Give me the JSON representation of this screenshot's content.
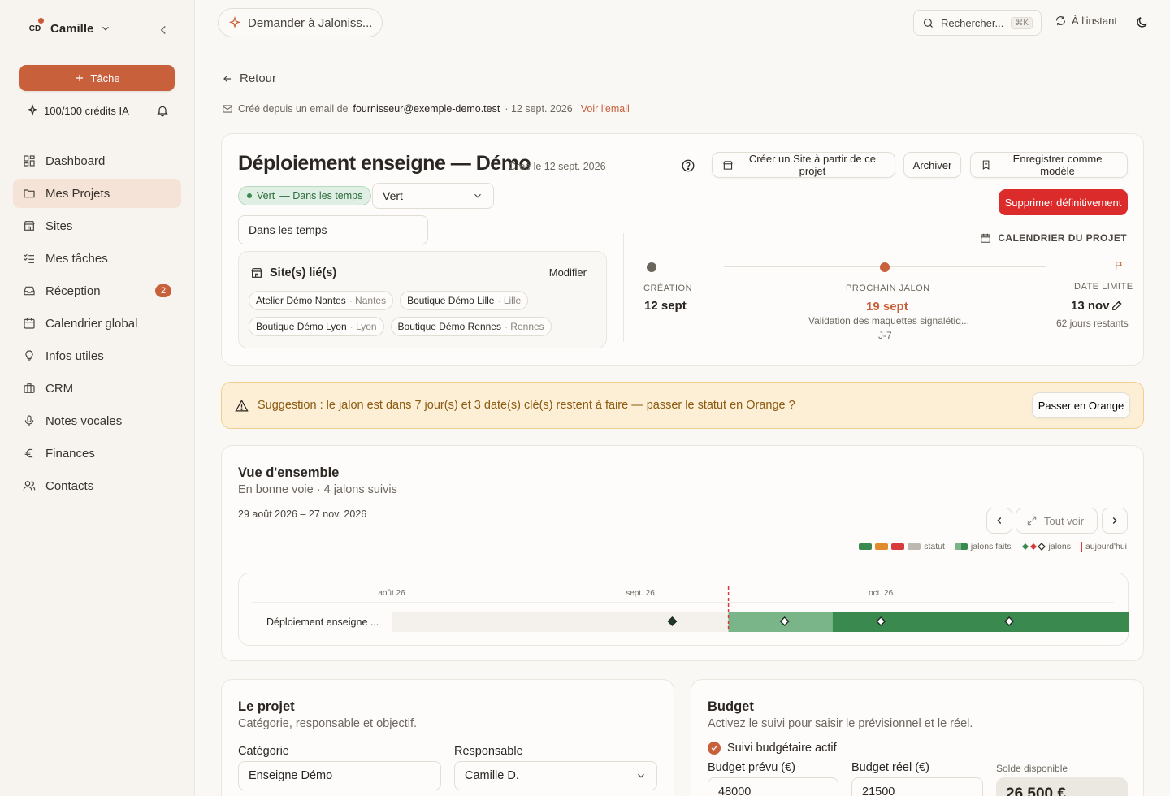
{
  "sidebar": {
    "avatar_initials": "CD",
    "user_name": "Camille",
    "task_button": "Tâche",
    "credits": "100/100 crédits IA",
    "items": [
      {
        "label": "Dashboard",
        "icon": "dashboard-icon"
      },
      {
        "label": "Mes Projets",
        "icon": "folder-icon",
        "active": true
      },
      {
        "label": "Sites",
        "icon": "store-icon"
      },
      {
        "label": "Mes tâches",
        "icon": "checklist-icon"
      },
      {
        "label": "Réception",
        "icon": "inbox-icon",
        "badge": "2"
      },
      {
        "label": "Calendrier global",
        "icon": "calendar-icon"
      },
      {
        "label": "Infos utiles",
        "icon": "lightbulb-icon"
      },
      {
        "label": "CRM",
        "icon": "briefcase-icon"
      },
      {
        "label": "Notes vocales",
        "icon": "microphone-icon"
      },
      {
        "label": "Finances",
        "icon": "euro-icon"
      },
      {
        "label": "Contacts",
        "icon": "users-icon"
      }
    ]
  },
  "topbar": {
    "ask": "Demander à Jaloniss...",
    "search": "Rechercher...",
    "shortcut": "⌘K",
    "sync": "À l'instant"
  },
  "back": "Retour",
  "source": {
    "prefix": "Créé depuis un email de",
    "email": "fournisseur@exemple-demo.test",
    "date": "· 12 sept. 2026",
    "link": "Voir l'email"
  },
  "project": {
    "title": "Déploiement enseigne — Démo",
    "created": "Créé le 12 sept. 2026",
    "btn_create_site": "Créer un Site à partir de ce projet",
    "btn_archive": "Archiver",
    "btn_template": "Enregistrer comme modèle",
    "btn_delete": "Supprimer définitivement",
    "status_chip": "Vert",
    "status_chip_note": "— Dans les temps",
    "status_select": "Vert",
    "status_note": "Dans les temps",
    "sites_title": "Site(s) lié(s)",
    "sites_edit": "Modifier",
    "sites": [
      {
        "name": "Atelier Démo Nantes",
        "city": "· Nantes"
      },
      {
        "name": "Boutique Démo Lille",
        "city": "· Lille"
      },
      {
        "name": "Boutique Démo Lyon",
        "city": "· Lyon"
      },
      {
        "name": "Boutique Démo Rennes",
        "city": "· Rennes"
      }
    ],
    "calendar_label": "CALENDRIER DU PROJET",
    "creation_label": "CRÉATION",
    "creation_date": "12 sept",
    "next_label": "PROCHAIN JALON",
    "next_date": "19 sept",
    "next_desc": "Validation des maquettes signalétiq...",
    "next_countdown": "J-7",
    "deadline_label": "DATE LIMITE",
    "deadline_date": "13 nov",
    "deadline_remaining": "62 jours restants"
  },
  "suggestion": {
    "text": "Suggestion : le jalon est dans 7 jour(s) et 3 date(s) clé(s) restent à faire — passer le statut en Orange ?",
    "button": "Passer en Orange"
  },
  "overview": {
    "title": "Vue d'ensemble",
    "subtitle": "En bonne voie · 4 jalons suivis",
    "range": "29 août 2026 – 27 nov. 2026",
    "see_all": "Tout voir",
    "legend": {
      "status": "statut",
      "done": "jalons faits",
      "milestones": "jalons",
      "today": "aujourd'hui"
    },
    "colors": {
      "green": "#3a8a50",
      "orange": "#e08c2c",
      "red": "#d83a3a",
      "grey": "#bdb8b1",
      "done": "#7ab58a"
    }
  },
  "chart_data": {
    "type": "gantt",
    "axis_ticks": [
      "août 26",
      "sept. 26",
      "oct. 26"
    ],
    "range": [
      "2026-08-29",
      "2026-11-27"
    ],
    "today": "2026-09-12",
    "rows": [
      {
        "label": "Déploiement enseigne ...",
        "start": "2026-09-12",
        "end": "2026-11-13",
        "done_until": "2026-09-25",
        "milestones": [
          "2026-09-05",
          "2026-09-19",
          "2026-10-01",
          "2026-10-17"
        ]
      }
    ]
  },
  "projet_section": {
    "title": "Le projet",
    "subtitle": "Catégorie, responsable et objectif.",
    "category_label": "Catégorie",
    "category_value": "Enseigne Démo",
    "owner_label": "Responsable",
    "owner_value": "Camille D."
  },
  "budget": {
    "title": "Budget",
    "subtitle": "Activez le suivi pour saisir le prévisionnel et le réel.",
    "active": "Suivi budgétaire actif",
    "planned_label": "Budget prévu (€)",
    "planned_value": "48000",
    "actual_label": "Budget réel (€)",
    "actual_value": "21500",
    "balance_label": "Solde disponible",
    "balance_value": "26 500 €"
  }
}
